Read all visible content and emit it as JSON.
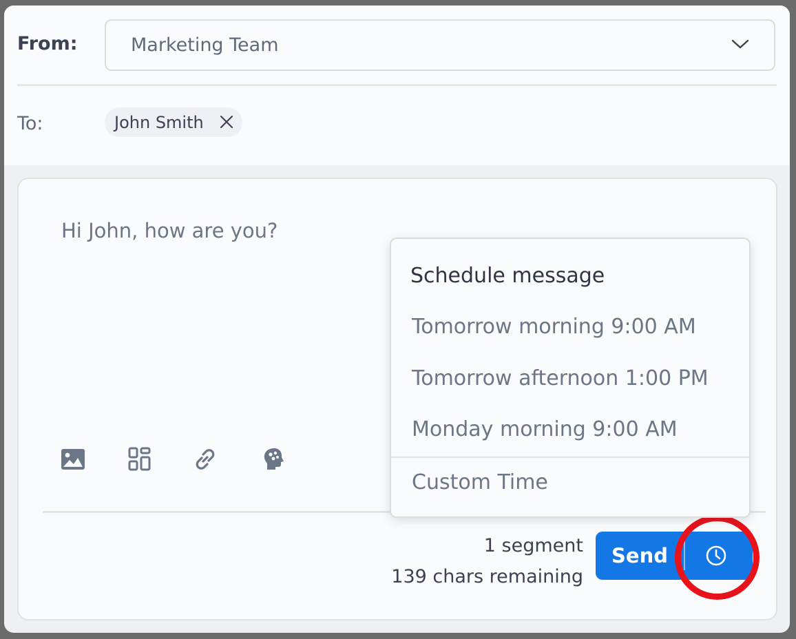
{
  "header": {
    "from_label": "From:",
    "from_value": "Marketing Team",
    "to_label": "To:",
    "recipient": "John Smith"
  },
  "composer": {
    "message": "Hi John, how are you?",
    "toolbar_icons": [
      "image-icon",
      "grid-icon",
      "link-icon",
      "brain-icon"
    ],
    "segments": "1 segment",
    "chars_remaining": "139 chars remaining",
    "send_label": "Send"
  },
  "schedule_menu": {
    "title": "Schedule message",
    "options": [
      "Tomorrow morning 9:00 AM",
      "Tomorrow afternoon 1:00 PM",
      "Monday morning 9:00 AM"
    ],
    "custom_label": "Custom Time"
  },
  "colors": {
    "accent": "#1477e6",
    "highlight": "#e8121b"
  }
}
